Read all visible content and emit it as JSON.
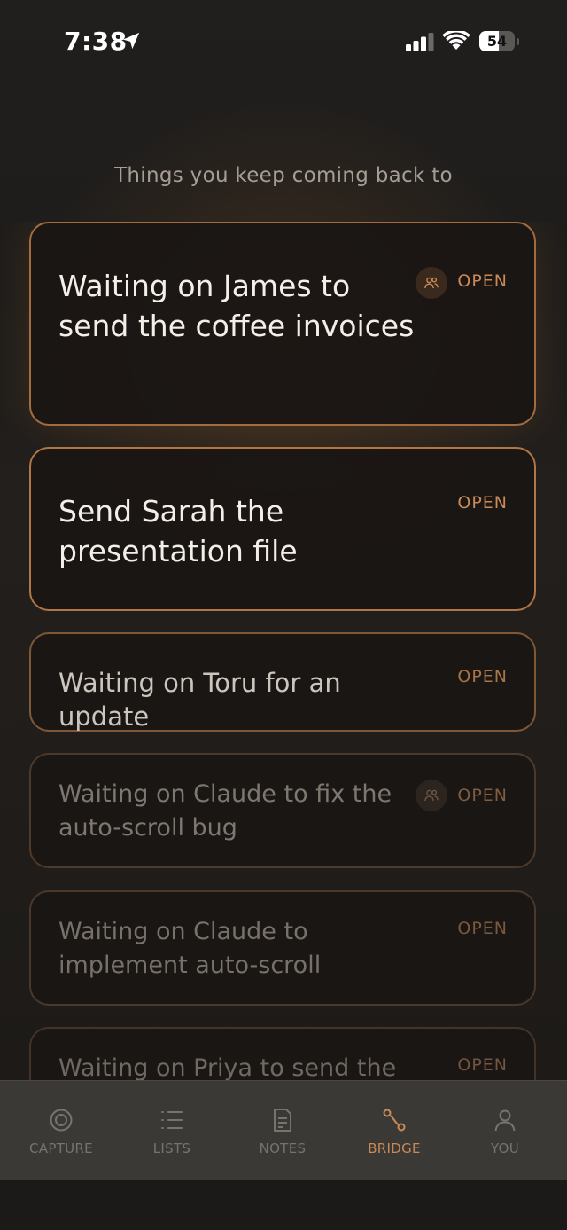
{
  "status_bar": {
    "time": "7:38",
    "battery": "54",
    "battery_level": 0.54
  },
  "heading": "Things you keep coming back to",
  "items": [
    {
      "title": "Waiting on James to send the coffee invoices",
      "status": "OPEN",
      "shared": true
    },
    {
      "title": "Send Sarah the presentation file",
      "status": "OPEN",
      "shared": false
    },
    {
      "title": "Waiting on Toru for an update",
      "status": "OPEN",
      "shared": false
    },
    {
      "title": "Waiting on Claude to fix the auto-scroll bug",
      "status": "OPEN",
      "shared": true
    },
    {
      "title": "Waiting on Claude to implement auto-scroll",
      "status": "OPEN",
      "shared": false
    },
    {
      "title": "Waiting on Priya to send the",
      "status": "OPEN",
      "shared": false
    }
  ],
  "tabs": [
    {
      "label": "CAPTURE",
      "icon": "target-icon",
      "active": false
    },
    {
      "label": "LISTS",
      "icon": "list-icon",
      "active": false
    },
    {
      "label": "NOTES",
      "icon": "note-icon",
      "active": false
    },
    {
      "label": "BRIDGE",
      "icon": "bridge-icon",
      "active": true
    },
    {
      "label": "YOU",
      "icon": "person-icon",
      "active": false
    }
  ],
  "colors": {
    "accent": "#c98a57",
    "background": "#1c1a18",
    "tab_bar": "#3b3935"
  }
}
